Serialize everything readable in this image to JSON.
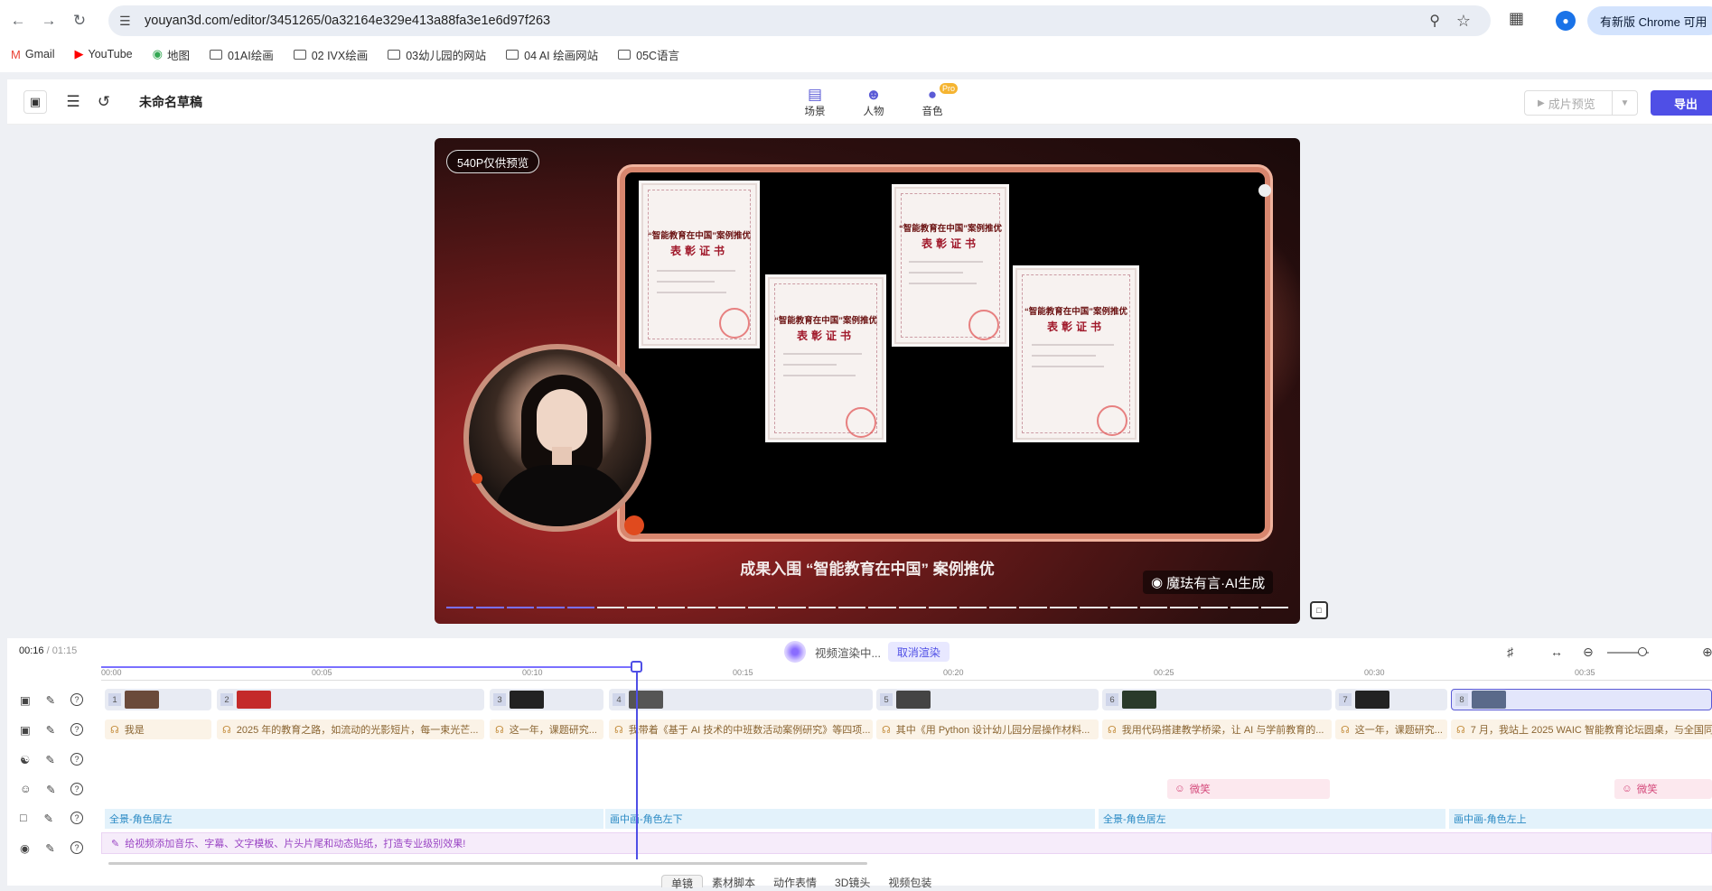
{
  "browser": {
    "url": "youyan3d.com/editor/3451265/0a32164e329e413a88fa3e1e6d97f263",
    "update_chip": "有新版 Chrome 可用",
    "bookmarks": [
      "Gmail",
      "YouTube",
      "地图",
      "01AI绘画",
      "02 IVX绘画",
      "03幼儿园的网站",
      "04 AI 绘画网站",
      "05C语言"
    ]
  },
  "header": {
    "draft_title": "未命名草稿",
    "nav": [
      {
        "label": "场景",
        "icon": "scene-icon"
      },
      {
        "label": "人物",
        "icon": "person-icon"
      },
      {
        "label": "音色",
        "icon": "mic-icon"
      }
    ],
    "pro_badge": "Pro",
    "preview_label": "成片预览",
    "export_label": "导出"
  },
  "preview": {
    "quality_badge": "540P仅供预览",
    "subtitle": "成果入围 “智能教育在中国” 案例推优",
    "watermark": "魔珐有言·AI生成",
    "cert_title": "“智能教育在中国”案例推优",
    "cert_sub": "表彰证书",
    "progress_done": 5,
    "progress_total": 28
  },
  "timeline": {
    "current_time": "00:16",
    "separator": " / ",
    "total_time": "01:15",
    "render_status": "视频渲染中...",
    "cancel_render": "取消渲染",
    "ticks": [
      "00:00",
      "00:05",
      "00:10",
      "00:15",
      "00:20",
      "00:25",
      "00:30",
      "00:35"
    ],
    "clips": [
      "1",
      "2",
      "3",
      "4",
      "5",
      "6",
      "7",
      "8"
    ],
    "audio": [
      "我是",
      "2025 年的教育之路，如流动的光影短片，每一束光芒...",
      "这一年，课题研究...",
      "我带着《基于 AI 技术的中班数活动案例研究》等四项...",
      "其中《用 Python 设计幼儿园分层操作材料...",
      "我用代码搭建教学桥梁，让 AI 与学前教育的...",
      "这一年，课题研究...",
      "7 月，我站上 2025 WAIC 智能教育论坛圆桌，与全国同仁..."
    ],
    "emotes": [
      "微笑",
      "微笑"
    ],
    "camera": [
      "全景-角色居左",
      "画中画-角色左下",
      "全景-角色居左",
      "画中画-角色左上"
    ],
    "fx_hint": "给视频添加音乐、字幕、文字模板、片头片尾和动态贴纸，打造专业级别效果!",
    "bottom_tabs": [
      "单镜",
      "素材脚本",
      "动作表情",
      "3D镜头",
      "视频包装"
    ]
  }
}
